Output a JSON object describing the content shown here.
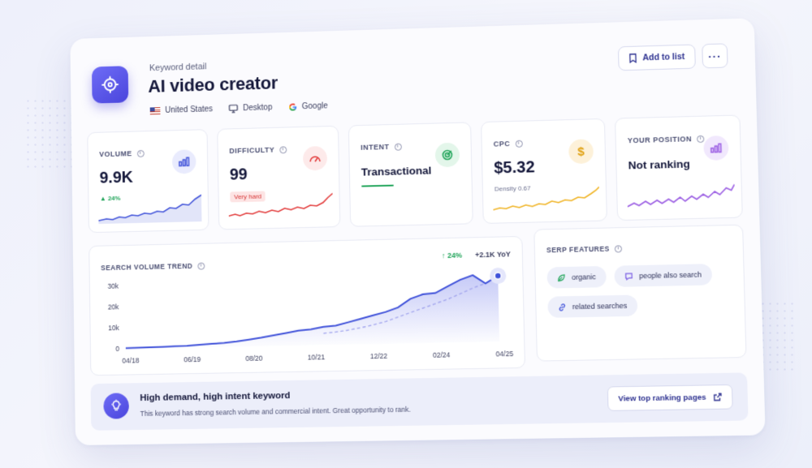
{
  "header": {
    "eyebrow": "Keyword detail",
    "title": "AI video creator",
    "country": "United States",
    "device": "Desktop",
    "engine": "Google",
    "add_to_list_label": "Add to list",
    "more_label": "···"
  },
  "metrics": {
    "volume": {
      "label": "VOLUME",
      "value": "9.9K",
      "change": "▲ 24%",
      "color": "#3f51d9"
    },
    "difficulty": {
      "label": "DIFFICULTY",
      "value": "99",
      "badge": "Very hard",
      "color": "#e23a3a"
    },
    "intent": {
      "label": "INTENT",
      "value": "Transactional",
      "color": "#22a55b"
    },
    "cpc": {
      "label": "CPC",
      "value": "$5.32",
      "sub": "Density 0.67",
      "color": "#f0b322"
    },
    "position": {
      "label": "YOUR POSITION",
      "value": "Not ranking",
      "color": "#9b5ee3"
    }
  },
  "trend": {
    "label": "SEARCH VOLUME TREND",
    "change": "↑ 24%",
    "yoy": "+2.1K YoY"
  },
  "chart_data": {
    "type": "area",
    "title": "SEARCH VOLUME TREND",
    "x_ticks": [
      "04/18",
      "06/19",
      "08/20",
      "10/21",
      "12/22",
      "02/24",
      "04/25"
    ],
    "y_ticks": [
      "0",
      "10k",
      "20k",
      "30k"
    ],
    "ylim": [
      0,
      33000
    ],
    "series": [
      {
        "values": [
          200,
          300,
          400,
          500,
          700,
          800,
          1200,
          1500,
          1800,
          2400,
          3200,
          4000,
          5000,
          6000,
          7000,
          7500,
          8500,
          9000,
          10500,
          12000,
          13500,
          15000,
          17000,
          21000,
          23000,
          23500,
          26500,
          29500,
          31500,
          27500,
          31000
        ]
      },
      {
        "values": [
          0,
          0,
          0,
          0,
          0,
          0,
          0,
          0,
          0,
          0,
          0,
          0,
          0,
          0,
          0,
          0,
          5500,
          6000,
          6800,
          7800,
          9000,
          10500,
          12500,
          14500,
          16500,
          18500,
          20500,
          23000,
          25500,
          27500,
          31000
        ]
      }
    ]
  },
  "serp": {
    "label": "SERP FEATURES",
    "chips": [
      "organic",
      "people also search",
      "related searches"
    ]
  },
  "banner": {
    "title": "High demand, high intent keyword",
    "text": "This keyword has strong search volume and commercial intent. Great opportunity to rank.",
    "button": "View top ranking pages"
  }
}
